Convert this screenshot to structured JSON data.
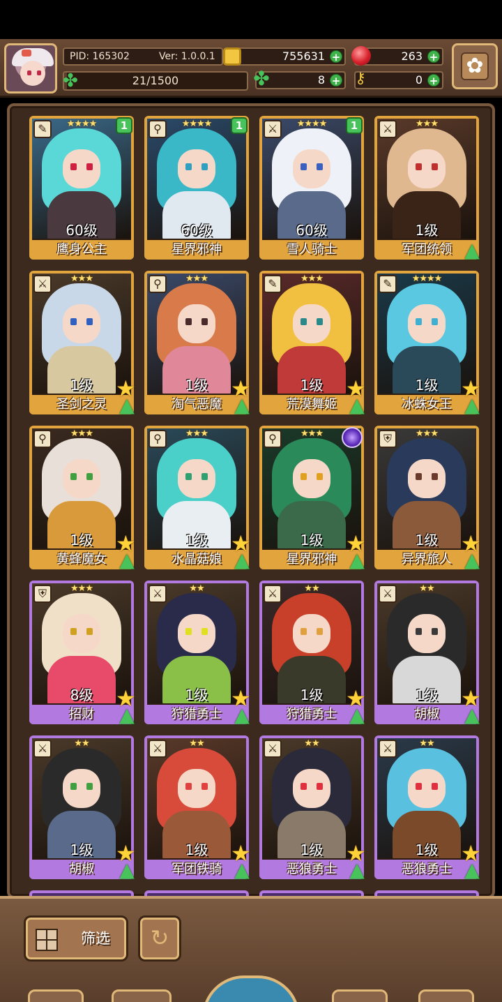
{
  "header": {
    "pid_text": "PID: 165302",
    "version_text": "Ver: 1.0.0.1",
    "coins": "755631",
    "gems": "263",
    "stamina": "21/1500",
    "stamina_fraction": 0.014,
    "clovers": "8",
    "keys": "0",
    "plus": "+",
    "settings_glyph": "✿"
  },
  "cards": [
    {
      "stars": "★★★★",
      "weapon": "staff-icon",
      "badge": "1",
      "level": "60级",
      "name": "鹰身公主",
      "rarity": "gold",
      "palette": {
        "bg": "#3a6a8a",
        "hair": "#5ad8d8",
        "body": "#4a3a40",
        "eye": "#d02040"
      }
    },
    {
      "stars": "★★★★",
      "weapon": "wand-icon",
      "badge": "1",
      "level": "60级",
      "name": "星界邪神",
      "rarity": "gold",
      "palette": {
        "bg": "#2a4a6a",
        "hair": "#3ab8c8",
        "body": "#e0e8f0",
        "eye": "#30a0c0"
      }
    },
    {
      "stars": "★★★★",
      "weapon": "sword-icon",
      "badge": "1",
      "level": "60级",
      "name": "雪人骑士",
      "rarity": "gold",
      "palette": {
        "bg": "#3a4a6a",
        "hair": "#eef2f8",
        "body": "#5a6a8a",
        "eye": "#3a60c0"
      }
    },
    {
      "stars": "★★★",
      "weapon": "sword-icon",
      "badge": "",
      "level": "1级",
      "name": "军团统领",
      "rarity": "gold",
      "palette": {
        "bg": "#5a3a2a",
        "hair": "#e0b890",
        "body": "#3a2418",
        "eye": "#c03030"
      },
      "upgrade": true
    },
    {
      "stars": "★★★",
      "weapon": "sword-icon",
      "badge": "",
      "level": "1级",
      "name": "圣剑之灵",
      "rarity": "gold",
      "palette": {
        "bg": "#4a3a2a",
        "hair": "#c8d8e8",
        "body": "#d8c8a0",
        "eye": "#3060c0"
      },
      "star": true,
      "upgrade": true
    },
    {
      "stars": "★★★",
      "weapon": "wand-icon",
      "badge": "",
      "level": "1级",
      "name": "淘气恶魔",
      "rarity": "gold",
      "palette": {
        "bg": "#3a4a6a",
        "hair": "#d87a4a",
        "body": "#e0889a",
        "eye": "#4a2a2a"
      },
      "star": true,
      "upgrade": true
    },
    {
      "stars": "★★★",
      "weapon": "staff-icon",
      "badge": "",
      "level": "1级",
      "name": "荒漠舞姬",
      "rarity": "gold",
      "palette": {
        "bg": "#5a2a2a",
        "hair": "#f2c040",
        "body": "#c03a3a",
        "eye": "#2a8a8a"
      },
      "star": true,
      "upgrade": true
    },
    {
      "stars": "★★★★",
      "weapon": "staff-icon",
      "badge": "",
      "level": "1级",
      "name": "冰蛛女王",
      "rarity": "gold",
      "palette": {
        "bg": "#1a3a4a",
        "hair": "#5ac8e0",
        "body": "#2a4a5a",
        "eye": "#40b0d0"
      },
      "star": true,
      "upgrade": true
    },
    {
      "stars": "★★★",
      "weapon": "wand-icon",
      "badge": "",
      "level": "1级",
      "name": "黄蜂魔女",
      "rarity": "gold",
      "palette": {
        "bg": "#3a2a20",
        "hair": "#e8e0d8",
        "body": "#d89a3a",
        "eye": "#40a040"
      },
      "star": true,
      "upgrade": true
    },
    {
      "stars": "★★★",
      "weapon": "wand-icon",
      "badge": "",
      "level": "1级",
      "name": "水晶菇娘",
      "rarity": "gold",
      "palette": {
        "bg": "#2a4a5a",
        "hair": "#4ad0c8",
        "body": "#e8eef2",
        "eye": "#30a070"
      },
      "star": true,
      "upgrade": true
    },
    {
      "stars": "★★★",
      "weapon": "wand-icon",
      "badge": "",
      "orb": true,
      "level": "1级",
      "name": "星界邪神",
      "rarity": "gold",
      "palette": {
        "bg": "#1a3a2a",
        "hair": "#2a8a5a",
        "body": "#3a6a4a",
        "eye": "#e0a020"
      },
      "star": true,
      "upgrade": true
    },
    {
      "stars": "★★★",
      "weapon": "shield-icon",
      "badge": "",
      "level": "1级",
      "name": "异界旅人",
      "rarity": "gold",
      "palette": {
        "bg": "#3a3a3a",
        "hair": "#2a3a5a",
        "body": "#8a5a3a",
        "eye": "#6a3a2a"
      },
      "star": true,
      "upgrade": true
    },
    {
      "stars": "★★★",
      "weapon": "shield-icon",
      "badge": "",
      "level": "8级",
      "name": "招财",
      "rarity": "purple",
      "palette": {
        "bg": "#4a3a2a",
        "hair": "#f0e0c8",
        "body": "#e84a6a",
        "eye": "#d0a020"
      },
      "star": true,
      "upgrade": true
    },
    {
      "stars": "★★",
      "weapon": "sword-icon",
      "badge": "",
      "level": "1级",
      "name": "狩猎勇士",
      "rarity": "purple",
      "palette": {
        "bg": "#4a3a2a",
        "hair": "#2a2a4a",
        "body": "#8ac048",
        "eye": "#e0e020"
      },
      "star": true,
      "upgrade": true
    },
    {
      "stars": "★★",
      "weapon": "sword-icon",
      "badge": "",
      "level": "1级",
      "name": "狩猎勇士",
      "rarity": "purple",
      "palette": {
        "bg": "#3a2a2a",
        "hair": "#c8402a",
        "body": "#3a3a2a",
        "eye": "#e0a040"
      },
      "star": true,
      "upgrade": true
    },
    {
      "stars": "★★",
      "weapon": "sword-icon",
      "badge": "",
      "level": "1级",
      "name": "胡椒",
      "rarity": "purple",
      "palette": {
        "bg": "#4a3a2a",
        "hair": "#2a2a2a",
        "body": "#d8d8d8",
        "eye": "#3a3a3a"
      },
      "star": true,
      "upgrade": true
    },
    {
      "stars": "★★",
      "weapon": "sword-icon",
      "badge": "",
      "level": "1级",
      "name": "胡椒",
      "rarity": "purple",
      "palette": {
        "bg": "#4a3a2a",
        "hair": "#2a2a2a",
        "body": "#5a6a8a",
        "eye": "#40a040"
      },
      "star": true,
      "upgrade": true
    },
    {
      "stars": "★★",
      "weapon": "sword-icon",
      "badge": "",
      "level": "1级",
      "name": "军团铁骑",
      "rarity": "purple",
      "palette": {
        "bg": "#5a3a2a",
        "hair": "#d84a3a",
        "body": "#9a5a3a",
        "eye": "#e04040"
      },
      "star": true,
      "upgrade": true
    },
    {
      "stars": "★★",
      "weapon": "sword-icon",
      "badge": "",
      "level": "1级",
      "name": "恶狼勇士",
      "rarity": "purple",
      "palette": {
        "bg": "#4a3a2a",
        "hair": "#2a2a3a",
        "body": "#8a7a6a",
        "eye": "#e03040"
      },
      "star": true,
      "upgrade": true
    },
    {
      "stars": "★★",
      "weapon": "sword-icon",
      "badge": "",
      "level": "1级",
      "name": "恶狼勇士",
      "rarity": "purple",
      "palette": {
        "bg": "#2a3a4a",
        "hair": "#5ac0e0",
        "body": "#7a4a2a",
        "eye": "#e03040"
      },
      "star": true,
      "upgrade": true
    }
  ],
  "bottom": {
    "filter_label": "筛选",
    "refresh_glyph": "↻"
  },
  "icons": {
    "staff-icon": "✎",
    "wand-icon": "⚲",
    "sword-icon": "⚔",
    "shield-icon": "⛨",
    "star": "★",
    "upgrade": "▲"
  }
}
